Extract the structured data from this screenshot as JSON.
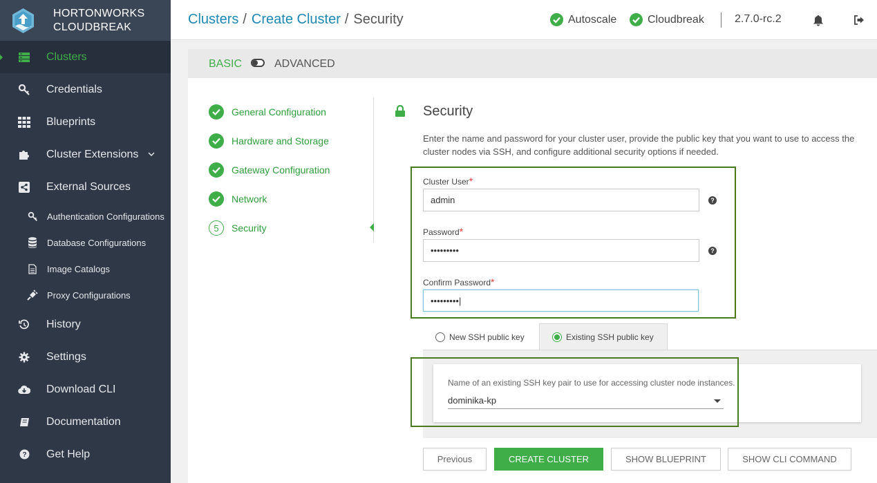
{
  "brand": {
    "line1": "HORTONWORKS",
    "line2": "CLOUDBREAK"
  },
  "sidebar": {
    "items": [
      {
        "label": "Clusters",
        "icon": "server-icon",
        "active": true
      },
      {
        "label": "Credentials",
        "icon": "key-icon"
      },
      {
        "label": "Blueprints",
        "icon": "grid-icon"
      },
      {
        "label": "Cluster Extensions",
        "icon": "puzzle-icon",
        "expandable": true
      },
      {
        "label": "External Sources",
        "icon": "share-icon"
      }
    ],
    "subitems": [
      {
        "label": "Authentication Configurations",
        "icon": "key-icon"
      },
      {
        "label": "Database Configurations",
        "icon": "database-icon"
      },
      {
        "label": "Image Catalogs",
        "icon": "file-icon"
      },
      {
        "label": "Proxy Configurations",
        "icon": "plug-icon"
      }
    ],
    "bottom_items": [
      {
        "label": "History",
        "icon": "history-icon"
      },
      {
        "label": "Settings",
        "icon": "gear-icon"
      },
      {
        "label": "Download CLI",
        "icon": "cloud-download-icon"
      },
      {
        "label": "Documentation",
        "icon": "book-icon"
      },
      {
        "label": "Get Help",
        "icon": "question-icon"
      }
    ]
  },
  "header": {
    "breadcrumb": {
      "root": "Clusters",
      "parent": "Create Cluster",
      "current": "Security"
    },
    "status_autoscale": "Autoscale",
    "status_cloudbreak": "Cloudbreak",
    "version": "2.7.0-rc.2"
  },
  "mode": {
    "basic": "BASIC",
    "advanced": "ADVANCED"
  },
  "steps": [
    {
      "label": "General Configuration",
      "done": true
    },
    {
      "label": "Hardware and Storage",
      "done": true
    },
    {
      "label": "Gateway Configuration",
      "done": true
    },
    {
      "label": "Network",
      "done": true
    },
    {
      "label": "Security",
      "number": "5",
      "done": false
    }
  ],
  "security": {
    "title": "Security",
    "description": "Enter the name and password for your cluster user, provide the public key that you want to use to access the cluster nodes via SSH, and configure additional security options if needed.",
    "cluster_user_label": "Cluster User",
    "cluster_user_value": "admin",
    "password_label": "Password",
    "password_value": "•••••••••",
    "confirm_label": "Confirm Password",
    "confirm_value": "•••••••••|",
    "required_mark": "*",
    "help_glyph": "?"
  },
  "ssh": {
    "tab_new": "New SSH public key",
    "tab_existing": "Existing SSH public key",
    "hint": "Name of an existing SSH key pair to use for accessing cluster node instances.",
    "selected": "dominika-kp"
  },
  "buttons": {
    "previous": "Previous",
    "create": "CREATE CLUSTER",
    "show_blueprint": "SHOW BLUEPRINT",
    "show_cli": "SHOW CLI COMMAND"
  },
  "colors": {
    "accent": "#3fae49",
    "link": "#1e88b4",
    "sidebar": "#2e3846",
    "highlight": "#4a7a1f"
  }
}
